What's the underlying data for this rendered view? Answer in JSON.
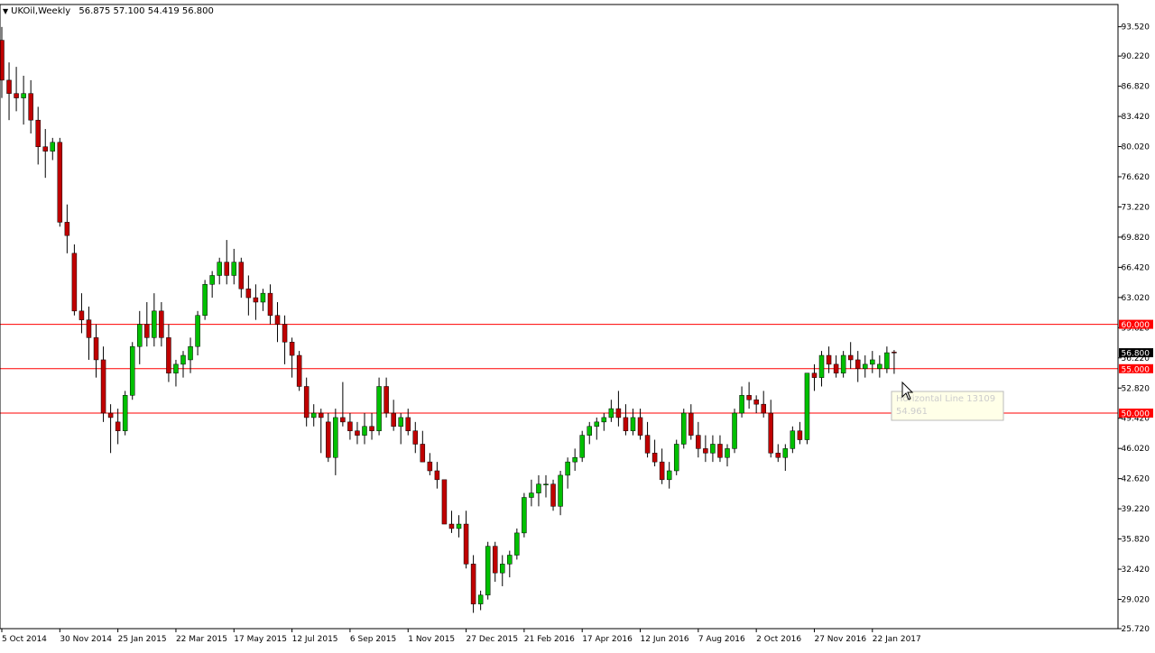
{
  "header": {
    "symbol": "UKOil,Weekly",
    "ohlc": "56.875 57.100 54.419 56.800"
  },
  "tooltip": {
    "line1": "Horizontal Line 13109",
    "line2": "54.961"
  },
  "colors": {
    "bull": "#00c000",
    "bear": "#c00000",
    "wick": "#000000",
    "hline": "#ff0000",
    "hline_label_bg": "#ff0000",
    "current_label_bg": "#000000"
  },
  "chart_data": {
    "type": "candlestick",
    "title": "",
    "timeframe": "Weekly",
    "ylim": [
      25.72,
      95.82
    ],
    "y_ticks": [
      "93.520",
      "90.220",
      "86.820",
      "83.420",
      "80.020",
      "76.620",
      "73.220",
      "69.820",
      "66.420",
      "63.020",
      "59.620",
      "56.220",
      "52.820",
      "49.420",
      "46.020",
      "42.620",
      "39.220",
      "35.820",
      "32.420",
      "29.020",
      "25.720"
    ],
    "x_ticks": [
      {
        "label": "5 Oct 2014",
        "index": 0
      },
      {
        "label": "30 Nov 2014",
        "index": 8
      },
      {
        "label": "25 Jan 2015",
        "index": 16
      },
      {
        "label": "22 Mar 2015",
        "index": 24
      },
      {
        "label": "17 May 2015",
        "index": 32
      },
      {
        "label": "12 Jul 2015",
        "index": 40
      },
      {
        "label": "6 Sep 2015",
        "index": 48
      },
      {
        "label": "1 Nov 2015",
        "index": 56
      },
      {
        "label": "27 Dec 2015",
        "index": 64
      },
      {
        "label": "21 Feb 2016",
        "index": 72
      },
      {
        "label": "17 Apr 2016",
        "index": 80
      },
      {
        "label": "12 Jun 2016",
        "index": 88
      },
      {
        "label": "7 Aug 2016",
        "index": 96
      },
      {
        "label": "2 Oct 2016",
        "index": 104
      },
      {
        "label": "27 Nov 2016",
        "index": 112
      },
      {
        "label": "22 Jan 2017",
        "index": 120
      }
    ],
    "horizontal_lines": [
      {
        "value": 60.0,
        "label": "60.000"
      },
      {
        "value": 55.0,
        "label": "55.000"
      },
      {
        "value": 50.0,
        "label": "50.000"
      }
    ],
    "current_price": {
      "value": 56.8,
      "label": "56.800"
    },
    "candles": [
      [
        92.0,
        93.5,
        85.5,
        87.5
      ],
      [
        87.5,
        89.5,
        83.0,
        86.0
      ],
      [
        86.0,
        89.0,
        84.0,
        85.5
      ],
      [
        85.5,
        88.0,
        82.5,
        86.0
      ],
      [
        86.0,
        87.5,
        81.5,
        83.0
      ],
      [
        83.0,
        84.5,
        78.0,
        80.0
      ],
      [
        80.0,
        82.0,
        76.5,
        79.5
      ],
      [
        79.5,
        81.0,
        78.5,
        80.5
      ],
      [
        80.5,
        81.0,
        71.0,
        71.5
      ],
      [
        71.5,
        73.5,
        68.0,
        70.0
      ],
      [
        68.0,
        69.0,
        61.0,
        61.5
      ],
      [
        61.5,
        63.5,
        59.0,
        60.5
      ],
      [
        60.5,
        62.0,
        56.0,
        58.5
      ],
      [
        58.5,
        60.0,
        54.0,
        56.0
      ],
      [
        56.0,
        57.5,
        49.0,
        50.0
      ],
      [
        50.0,
        51.0,
        45.5,
        49.5
      ],
      [
        49.0,
        50.5,
        46.5,
        48.0
      ],
      [
        48.0,
        52.5,
        47.5,
        52.0
      ],
      [
        52.0,
        58.0,
        51.5,
        57.5
      ],
      [
        57.5,
        61.5,
        55.5,
        60.0
      ],
      [
        60.0,
        62.5,
        57.5,
        58.5
      ],
      [
        58.5,
        63.5,
        57.5,
        61.5
      ],
      [
        61.5,
        62.5,
        57.5,
        58.5
      ],
      [
        58.5,
        60.0,
        53.5,
        54.5
      ],
      [
        54.5,
        56.0,
        53.0,
        55.5
      ],
      [
        55.5,
        57.0,
        54.0,
        56.5
      ],
      [
        56.0,
        58.5,
        54.5,
        57.5
      ],
      [
        57.5,
        61.5,
        56.5,
        61.0
      ],
      [
        61.0,
        65.0,
        60.5,
        64.5
      ],
      [
        64.5,
        66.0,
        63.0,
        65.5
      ],
      [
        65.5,
        67.5,
        64.5,
        67.0
      ],
      [
        67.0,
        69.5,
        64.5,
        65.5
      ],
      [
        65.5,
        68.5,
        64.5,
        67.0
      ],
      [
        67.0,
        67.5,
        63.0,
        64.0
      ],
      [
        64.0,
        65.5,
        61.0,
        63.0
      ],
      [
        63.0,
        64.5,
        60.5,
        62.5
      ],
      [
        62.5,
        64.0,
        61.5,
        63.5
      ],
      [
        63.5,
        64.5,
        60.0,
        61.0
      ],
      [
        61.0,
        62.5,
        58.0,
        60.0
      ],
      [
        60.0,
        61.0,
        55.5,
        58.0
      ],
      [
        58.0,
        58.5,
        54.0,
        56.5
      ],
      [
        56.5,
        57.0,
        52.5,
        53.0
      ],
      [
        53.0,
        54.0,
        48.5,
        49.5
      ],
      [
        49.5,
        51.0,
        48.5,
        50.0
      ],
      [
        50.0,
        50.5,
        45.5,
        49.5
      ],
      [
        49.0,
        50.0,
        44.5,
        45.0
      ],
      [
        45.0,
        50.5,
        43.0,
        49.5
      ],
      [
        49.5,
        53.5,
        48.5,
        49.0
      ],
      [
        49.0,
        50.0,
        47.0,
        48.0
      ],
      [
        48.0,
        49.0,
        46.5,
        47.5
      ],
      [
        47.5,
        50.0,
        46.5,
        48.5
      ],
      [
        48.5,
        50.0,
        47.0,
        48.0
      ],
      [
        48.0,
        54.0,
        47.5,
        53.0
      ],
      [
        53.0,
        54.0,
        49.5,
        50.0
      ],
      [
        50.0,
        51.5,
        48.0,
        48.5
      ],
      [
        48.5,
        50.0,
        46.5,
        49.5
      ],
      [
        49.5,
        50.5,
        47.5,
        48.0
      ],
      [
        48.0,
        49.0,
        45.5,
        46.5
      ],
      [
        46.5,
        48.0,
        44.5,
        44.5
      ],
      [
        44.5,
        45.5,
        43.0,
        43.5
      ],
      [
        43.5,
        44.5,
        41.5,
        42.5
      ],
      [
        42.5,
        42.0,
        37.5,
        37.5
      ],
      [
        37.5,
        39.0,
        36.5,
        37.0
      ],
      [
        37.0,
        38.5,
        36.0,
        37.5
      ],
      [
        37.5,
        39.0,
        32.5,
        33.0
      ],
      [
        33.0,
        34.0,
        27.5,
        28.5
      ],
      [
        28.5,
        30.0,
        27.8,
        29.5
      ],
      [
        29.5,
        35.5,
        29.0,
        35.0
      ],
      [
        35.0,
        35.5,
        31.0,
        32.0
      ],
      [
        32.0,
        34.0,
        30.5,
        33.0
      ],
      [
        33.0,
        34.5,
        31.5,
        34.0
      ],
      [
        34.0,
        37.0,
        33.5,
        36.5
      ],
      [
        36.5,
        41.0,
        36.0,
        40.5
      ],
      [
        40.5,
        42.5,
        39.5,
        41.0
      ],
      [
        41.0,
        43.0,
        39.5,
        42.0
      ],
      [
        42.0,
        43.0,
        40.5,
        42.0
      ],
      [
        42.0,
        42.5,
        39.0,
        39.5
      ],
      [
        39.5,
        43.5,
        38.5,
        43.0
      ],
      [
        43.0,
        45.0,
        41.5,
        44.5
      ],
      [
        44.5,
        46.0,
        43.5,
        45.0
      ],
      [
        45.0,
        48.0,
        44.5,
        47.5
      ],
      [
        47.5,
        49.0,
        46.5,
        48.5
      ],
      [
        48.5,
        49.5,
        47.0,
        49.0
      ],
      [
        49.0,
        50.0,
        48.0,
        49.5
      ],
      [
        49.5,
        51.5,
        49.0,
        50.5
      ],
      [
        50.5,
        52.5,
        48.5,
        49.5
      ],
      [
        49.5,
        51.0,
        47.5,
        48.0
      ],
      [
        48.0,
        50.5,
        47.5,
        49.5
      ],
      [
        49.5,
        50.5,
        47.0,
        47.5
      ],
      [
        47.5,
        49.0,
        45.0,
        45.5
      ],
      [
        45.5,
        47.0,
        44.0,
        44.5
      ],
      [
        44.5,
        46.0,
        42.0,
        42.5
      ],
      [
        42.5,
        44.5,
        41.5,
        43.5
      ],
      [
        43.5,
        47.0,
        43.0,
        46.5
      ],
      [
        46.5,
        50.5,
        46.0,
        50.0
      ],
      [
        50.0,
        51.0,
        47.0,
        47.5
      ],
      [
        47.5,
        49.0,
        45.0,
        46.0
      ],
      [
        46.0,
        47.5,
        44.5,
        45.5
      ],
      [
        45.5,
        47.5,
        44.5,
        46.5
      ],
      [
        46.5,
        47.5,
        44.5,
        45.0
      ],
      [
        45.0,
        46.5,
        44.0,
        46.0
      ],
      [
        46.0,
        50.5,
        45.5,
        50.0
      ],
      [
        50.0,
        53.0,
        49.5,
        52.0
      ],
      [
        52.0,
        53.5,
        50.5,
        51.5
      ],
      [
        51.5,
        52.0,
        50.0,
        51.0
      ],
      [
        51.0,
        52.5,
        49.5,
        50.0
      ],
      [
        50.0,
        51.5,
        45.0,
        45.5
      ],
      [
        45.5,
        46.5,
        44.5,
        45.0
      ],
      [
        45.0,
        46.5,
        43.5,
        46.0
      ],
      [
        46.0,
        48.5,
        45.5,
        48.0
      ],
      [
        48.0,
        49.0,
        46.5,
        47.0
      ],
      [
        47.0,
        54.5,
        46.5,
        54.5
      ],
      [
        54.5,
        55.5,
        52.5,
        54.0
      ],
      [
        54.0,
        57.0,
        53.0,
        56.5
      ],
      [
        56.5,
        57.5,
        54.5,
        55.5
      ],
      [
        55.5,
        56.5,
        54.0,
        54.5
      ],
      [
        54.5,
        57.0,
        54.0,
        56.5
      ],
      [
        56.5,
        58.0,
        55.0,
        56.0
      ],
      [
        56.0,
        57.0,
        53.5,
        55.0
      ],
      [
        55.0,
        56.5,
        54.0,
        55.5
      ],
      [
        55.5,
        57.0,
        54.5,
        56.0
      ],
      [
        55.0,
        56.5,
        54.0,
        55.5
      ],
      [
        55.0,
        57.5,
        54.5,
        56.8
      ],
      [
        56.875,
        57.1,
        54.419,
        56.8
      ]
    ]
  }
}
